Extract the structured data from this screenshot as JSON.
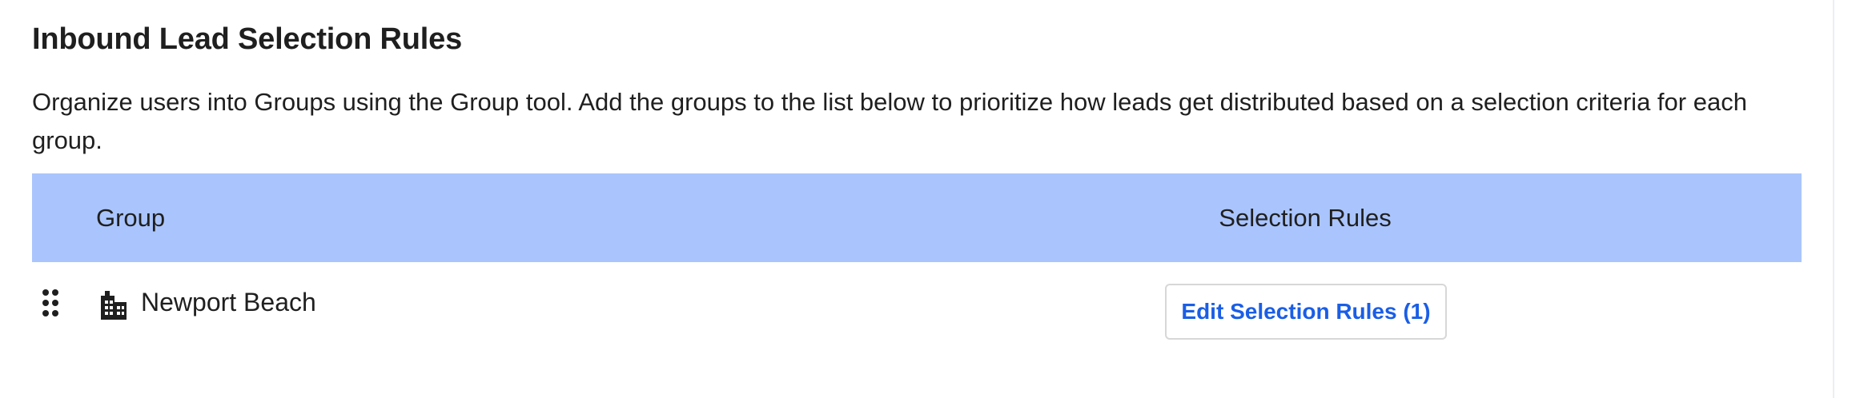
{
  "page": {
    "title": "Inbound Lead Selection Rules",
    "description": "Organize users into Groups using the Group tool. Add the groups to the list below to prioritize how leads get distributed based on a selection criteria for each group."
  },
  "table": {
    "headers": {
      "group": "Group",
      "selection_rules": "Selection Rules"
    },
    "header_color": "#aac5fd",
    "rows": [
      {
        "drag_icon": "drag-handle-icon",
        "group_icon": "building-icon",
        "group_name": "Newport Beach",
        "action_label": "Edit Selection Rules (1)"
      }
    ]
  },
  "colors": {
    "accent": "#1a5ee6",
    "text": "#1f1f1f"
  }
}
